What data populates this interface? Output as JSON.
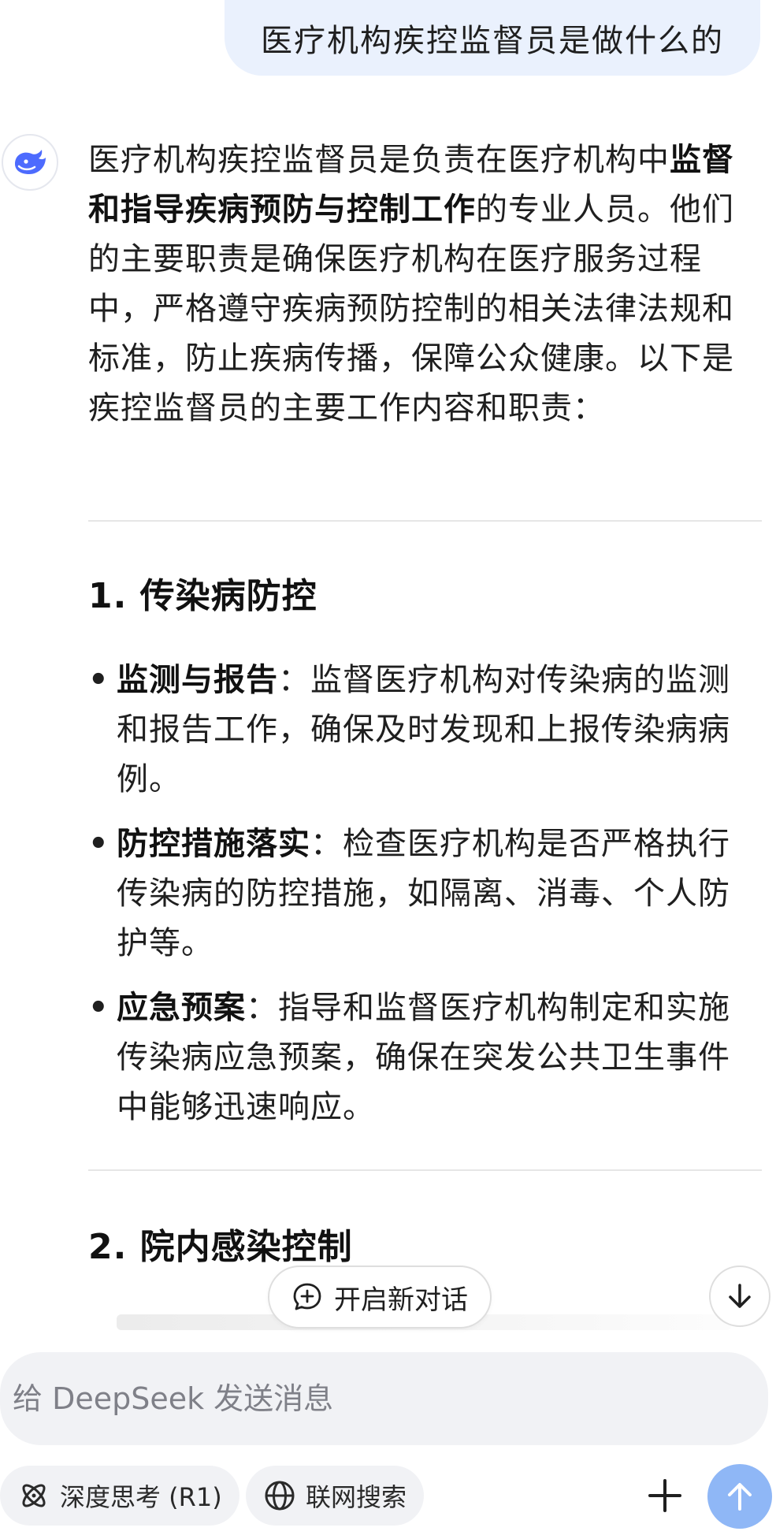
{
  "user_message": "医疗机构疾控监督员是做什么的",
  "answer": {
    "intro_pre": "医疗机构疾控监督员是负责在医疗机构中",
    "intro_bold": "监督和指导疾病预防与控制工作",
    "intro_post": "的专业人员。他们的主要职责是确保医疗机构在医疗服务过程中，严格遵守疾病预防控制的相关法律法规和标准，防止疾病传播，保障公众健康。以下是疾控监督员的主要工作内容和职责：",
    "sections": [
      {
        "heading": "1. 传染病防控",
        "bullets": [
          {
            "term": "监测与报告",
            "text": "：监督医疗机构对传染病的监测和报告工作，确保及时发现和上报传染病病例。"
          },
          {
            "term": "防控措施落实",
            "text": "：检查医疗机构是否严格执行传染病的防控措施，如隔离、消毒、个人防护等。"
          },
          {
            "term": "应急预案",
            "text": "：指导和监督医疗机构制定和实施传染病应急预案，确保在突发公共卫生事件中能够迅速响应。"
          }
        ]
      },
      {
        "heading": "2. 院内感染控制",
        "bullets": []
      }
    ]
  },
  "new_chat_label": "开启新对话",
  "input": {
    "placeholder": "给 DeepSeek 发送消息"
  },
  "toolbar": {
    "deep_think_label": "深度思考 (R1)",
    "web_search_label": "联网搜索"
  },
  "colors": {
    "user_bubble": "#eaf1fd",
    "brand_blue": "#4d6bfe",
    "send_button": "#8fb7f6"
  },
  "icons": [
    "deepseek-logo-icon",
    "chat-plus-icon",
    "arrow-down-icon",
    "atom-icon",
    "globe-icon",
    "plus-icon",
    "arrow-up-icon"
  ]
}
